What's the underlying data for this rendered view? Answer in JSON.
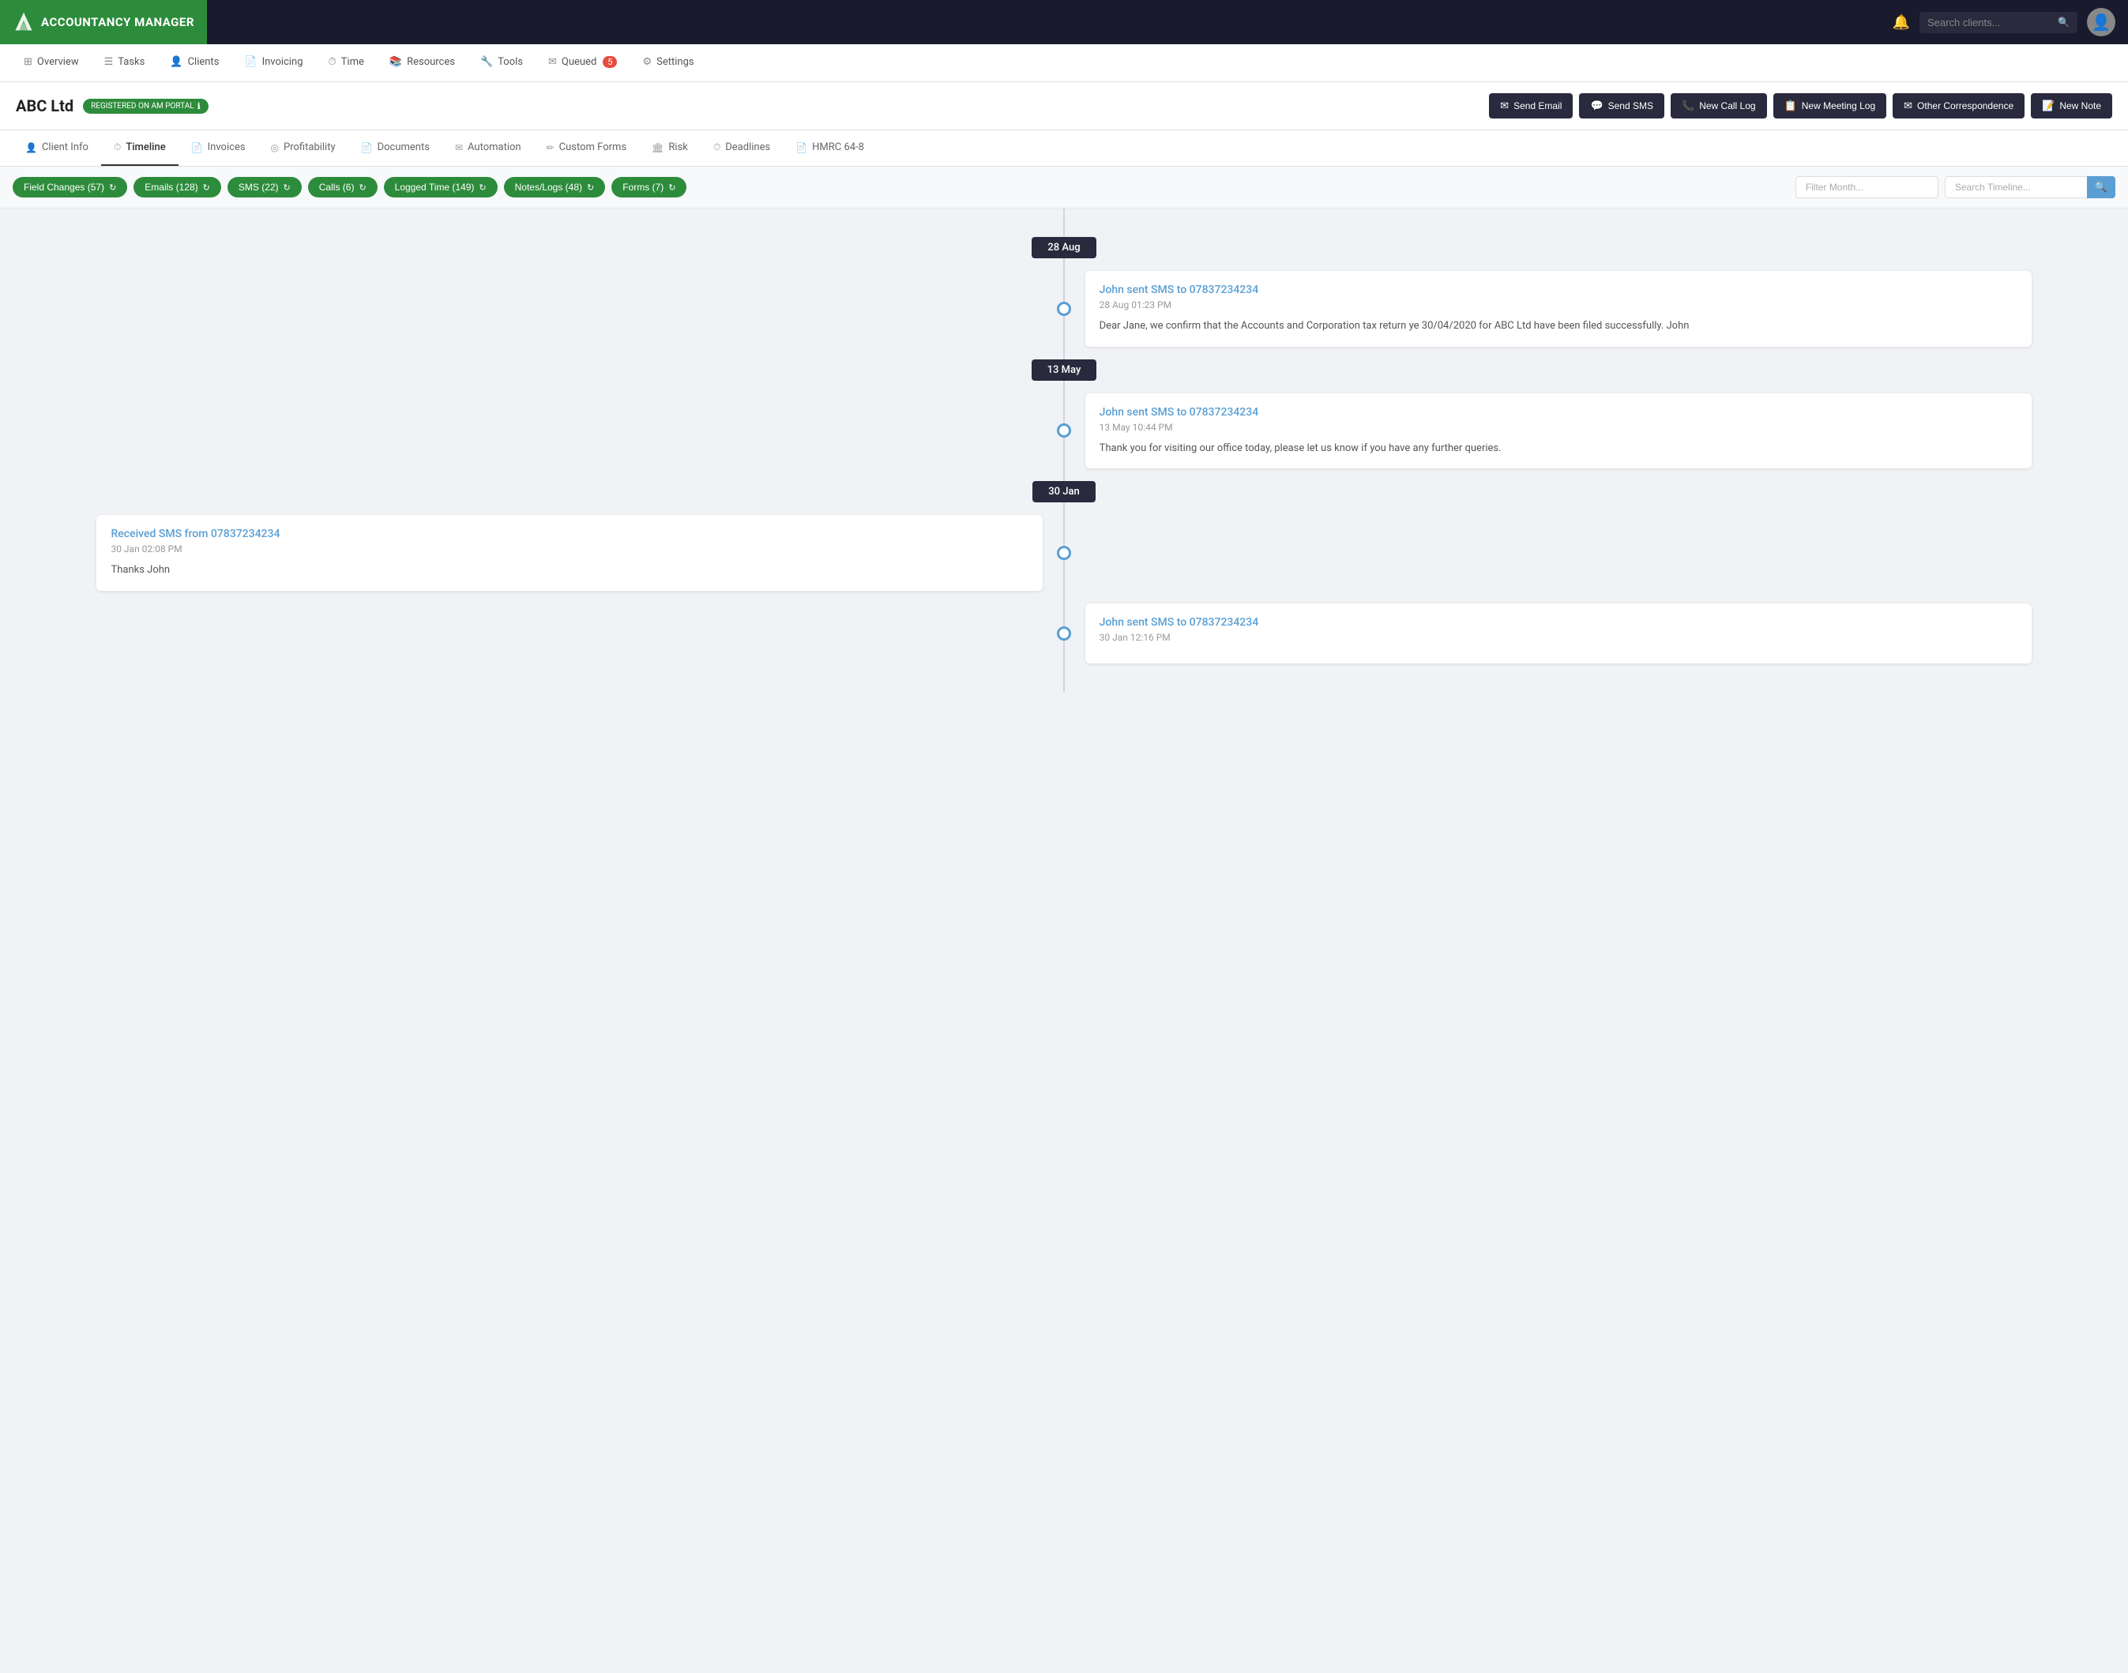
{
  "app": {
    "name": "ACCOUNTANCY MANAGER",
    "logo_unicode": "▲▲"
  },
  "topbar": {
    "search_placeholder": "Search clients...",
    "queued_count": "5"
  },
  "mainnav": {
    "items": [
      {
        "label": "Overview",
        "icon": "⊞"
      },
      {
        "label": "Tasks",
        "icon": "☰"
      },
      {
        "label": "Clients",
        "icon": "👤"
      },
      {
        "label": "Invoicing",
        "icon": "📄"
      },
      {
        "label": "Time",
        "icon": "⏱"
      },
      {
        "label": "Resources",
        "icon": "📚"
      },
      {
        "label": "Tools",
        "icon": "🔧"
      },
      {
        "label": "Queued",
        "icon": "✉",
        "badge": "5"
      },
      {
        "label": "Settings",
        "icon": "⚙"
      }
    ]
  },
  "client": {
    "name": "ABC Ltd",
    "badge": "REGISTERED ON AM PORTAL",
    "badge_info": "ℹ"
  },
  "action_buttons": [
    {
      "label": "Send Email",
      "icon": "✉",
      "key": "send-email"
    },
    {
      "label": "Send SMS",
      "icon": "💬",
      "key": "send-sms"
    },
    {
      "label": "New Call Log",
      "icon": "📞",
      "key": "new-call-log"
    },
    {
      "label": "New Meeting Log",
      "icon": "📋",
      "key": "new-meeting-log"
    },
    {
      "label": "Other Correspondence",
      "icon": "✉",
      "key": "other-correspondence"
    },
    {
      "label": "New Note",
      "icon": "📝",
      "key": "new-note"
    }
  ],
  "tabs": [
    {
      "label": "Client Info",
      "icon": "👤",
      "active": false
    },
    {
      "label": "Timeline",
      "icon": "⏱",
      "active": true
    },
    {
      "label": "Invoices",
      "icon": "📄",
      "active": false
    },
    {
      "label": "Profitability",
      "icon": "◎",
      "active": false
    },
    {
      "label": "Documents",
      "icon": "📄",
      "active": false
    },
    {
      "label": "Automation",
      "icon": "✉",
      "active": false
    },
    {
      "label": "Custom Forms",
      "icon": "✏",
      "active": false
    },
    {
      "label": "Risk",
      "icon": "🏛",
      "active": false
    },
    {
      "label": "Deadlines",
      "icon": "⏱",
      "active": false
    },
    {
      "label": "HMRC 64-8",
      "icon": "📄",
      "active": false
    }
  ],
  "filters": [
    {
      "label": "Field Changes (57)",
      "key": "field-changes"
    },
    {
      "label": "Emails (128)",
      "key": "emails"
    },
    {
      "label": "SMS (22)",
      "key": "sms"
    },
    {
      "label": "Calls (6)",
      "key": "calls"
    },
    {
      "label": "Logged Time (149)",
      "key": "logged-time"
    },
    {
      "label": "Notes/Logs (48)",
      "key": "notes-logs"
    },
    {
      "label": "Forms (7)",
      "key": "forms"
    }
  ],
  "filter_month_placeholder": "Filter Month...",
  "search_timeline_placeholder": "Search Timeline...",
  "timeline": {
    "groups": [
      {
        "date": "28 Aug",
        "entries": [
          {
            "side": "right",
            "title": "John sent SMS to 07837234234",
            "time": "28 Aug 01:23 PM",
            "body": "Dear Jane, we confirm that the Accounts and Corporation tax return ye 30/04/2020 for ABC Ltd have been filed successfully. John"
          }
        ]
      },
      {
        "date": "13 May",
        "entries": [
          {
            "side": "right",
            "title": "John sent SMS to 07837234234",
            "time": "13 May 10:44 PM",
            "body": "Thank you for visiting our office today, please let us know if you have any further queries."
          }
        ]
      },
      {
        "date": "30 Jan",
        "entries": [
          {
            "side": "left",
            "title": "Received SMS from 07837234234",
            "time": "30 Jan 02:08 PM",
            "body": "Thanks John"
          },
          {
            "side": "right",
            "title": "John sent SMS to 07837234234",
            "time": "30 Jan 12:16 PM",
            "body": ""
          }
        ]
      }
    ]
  }
}
